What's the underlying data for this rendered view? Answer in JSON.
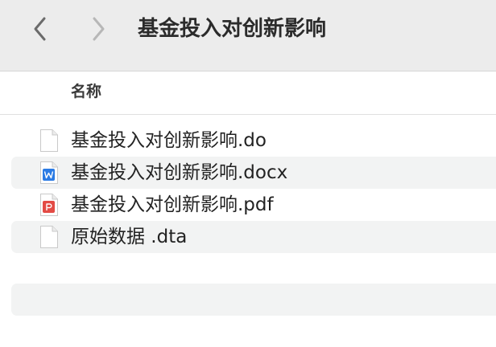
{
  "toolbar": {
    "back_icon": "chevron-left-icon",
    "forward_icon": "chevron-right-icon",
    "title": "基金投入对创新影响"
  },
  "columns": {
    "name": "名称"
  },
  "files": [
    {
      "name": "基金投入对创新影响.do",
      "icon": "blank-document-icon"
    },
    {
      "name": "基金投入对创新影响.docx",
      "icon": "word-document-icon"
    },
    {
      "name": "基金投入对创新影响.pdf",
      "icon": "pdf-document-icon"
    },
    {
      "name": "原始数据 .dta",
      "icon": "blank-document-icon"
    }
  ],
  "colors": {
    "toolbar_bg": "#ececec",
    "stripe": "#f2f3f3",
    "word_blue": "#2b7be4",
    "pdf_red": "#e34b45"
  }
}
